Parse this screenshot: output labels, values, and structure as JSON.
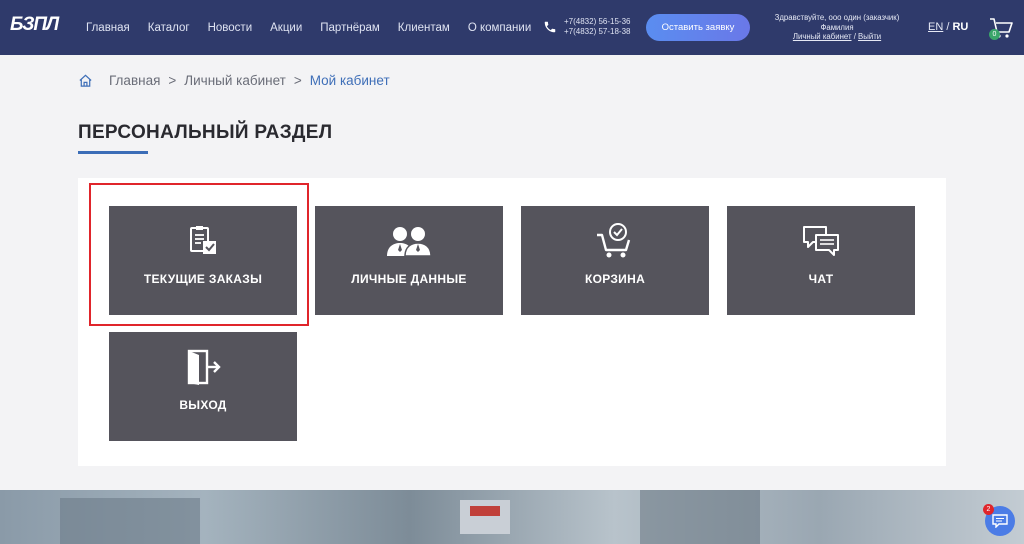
{
  "header": {
    "logo_text": "БЗПЛ",
    "nav": [
      "Главная",
      "Каталог",
      "Новости",
      "Акции",
      "Партнёрам",
      "Клиентам",
      "О компании"
    ],
    "phones": [
      "+7(4832) 56-15-36",
      "+7(4832) 57-18-38"
    ],
    "cta_label": "Оставить заявку",
    "greeting": "Здравствуйте, ооо один (заказчик)",
    "user_name": "Фамилия",
    "account_link": "Личный кабинет",
    "link_sep": "/",
    "logout_link": "Выйти",
    "lang_en": "EN",
    "lang_sep": "/",
    "lang_ru": "RU",
    "cart_count": "0"
  },
  "breadcrumb": {
    "items": [
      "Главная",
      "Личный кабинет",
      "Мой кабинет"
    ],
    "sep": ">"
  },
  "page_title": "ПЕРСОНАЛЬНЫЙ РАЗДЕЛ",
  "tiles": [
    {
      "label": "ТЕКУЩИЕ ЗАКАЗЫ",
      "icon": "orders-icon"
    },
    {
      "label": "ЛИЧНЫЕ ДАННЫЕ",
      "icon": "users-icon"
    },
    {
      "label": "КОРЗИНА",
      "icon": "cart-check-icon"
    },
    {
      "label": "ЧАТ",
      "icon": "chat-icon"
    },
    {
      "label": "ВЫХОД",
      "icon": "exit-icon"
    }
  ],
  "chat_widget_count": "2",
  "colors": {
    "header_bg": "#2f3a6b",
    "tile_bg": "#55545c",
    "accent": "#3b6db7",
    "highlight": "#e0252b"
  }
}
